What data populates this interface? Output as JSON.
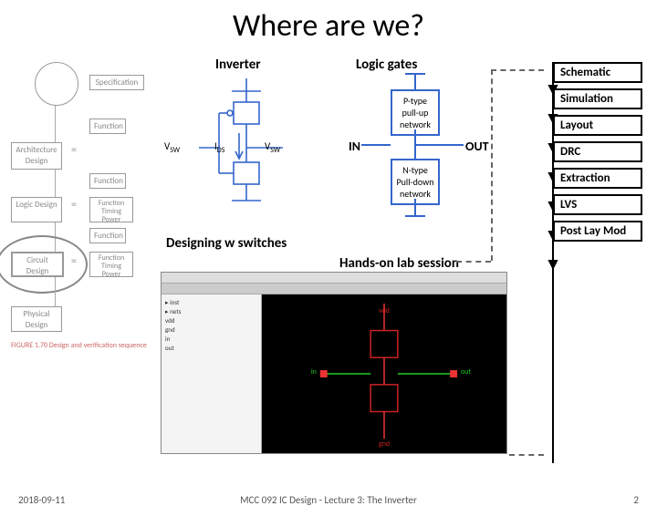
{
  "title": "Where are we?",
  "footer": {
    "date": "2018-09-11",
    "center": "MCC 092 IC Design - Lecture 3: The Inverter",
    "page": "2"
  },
  "labels": {
    "inverter": "Inverter",
    "logic_gates": "Logic gates",
    "out": "OUT",
    "in": "IN",
    "design_sw": "Designing w switches",
    "hands_on": "Hands-on lab session"
  },
  "symbols": {
    "vsw": "V",
    "vsw_sub": "SW",
    "ids": "I",
    "ids_sub": "DS"
  },
  "networks": {
    "p": "P-type pull-up network",
    "n": "N-type Pull-down network"
  },
  "leftflow": {
    "spec": "Specification",
    "func": "Function",
    "arch": "Architecture Design",
    "logic": "Logic Design",
    "circuit": "Circuit Design",
    "physical": "Physical Design",
    "ftp": "Function Timing Power",
    "figcap": "FIGURE 1.70 Design and verification sequence"
  },
  "rightflow": [
    "Schematic",
    "Simulation",
    "Layout",
    "DRC",
    "Extraction",
    "LVS",
    "Post Lay Mod"
  ],
  "eda": {
    "tree": [
      "▸ inst",
      "▸ nets",
      "  vdd",
      "  gnd",
      "  in",
      "  out"
    ]
  }
}
